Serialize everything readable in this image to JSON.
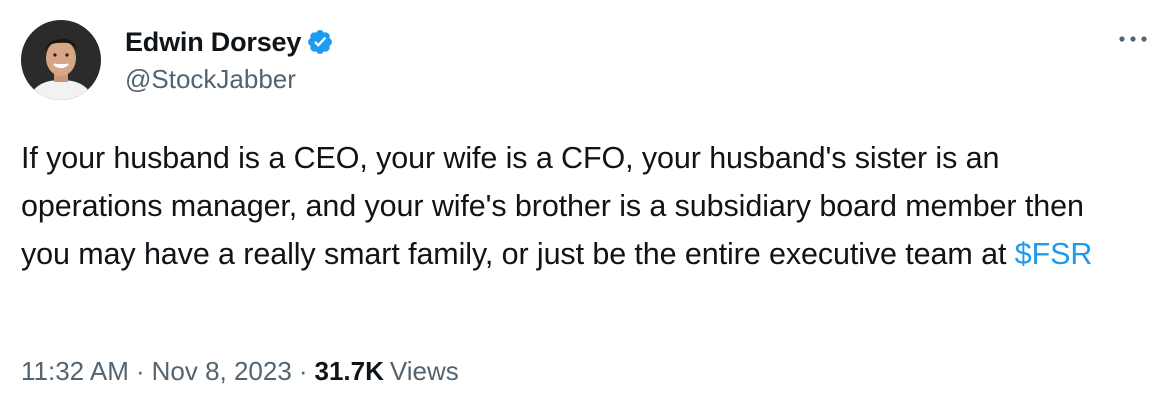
{
  "author": {
    "display_name": "Edwin Dorsey",
    "handle": "@StockJabber",
    "verified": true,
    "avatar_icon": "user-avatar-photo",
    "verified_icon": "verified-badge-icon"
  },
  "tweet": {
    "text_before_cashtag": "If your husband is a CEO, your wife is a CFO, your husband's sister is an operations manager, and your wife's brother is a subsidiary board member then you may have a really smart family, or just be the entire executive team at ",
    "cashtag": "$FSR"
  },
  "meta": {
    "time": "11:32 AM",
    "separator": "·",
    "date": "Nov 8, 2023",
    "views_count": "31.7K",
    "views_label": "Views"
  },
  "menu": {
    "icon": "more-options-icon"
  },
  "colors": {
    "text_primary": "#0f1419",
    "text_secondary": "#536471",
    "link": "#1d9bf0",
    "verified": "#1d9bf0"
  }
}
